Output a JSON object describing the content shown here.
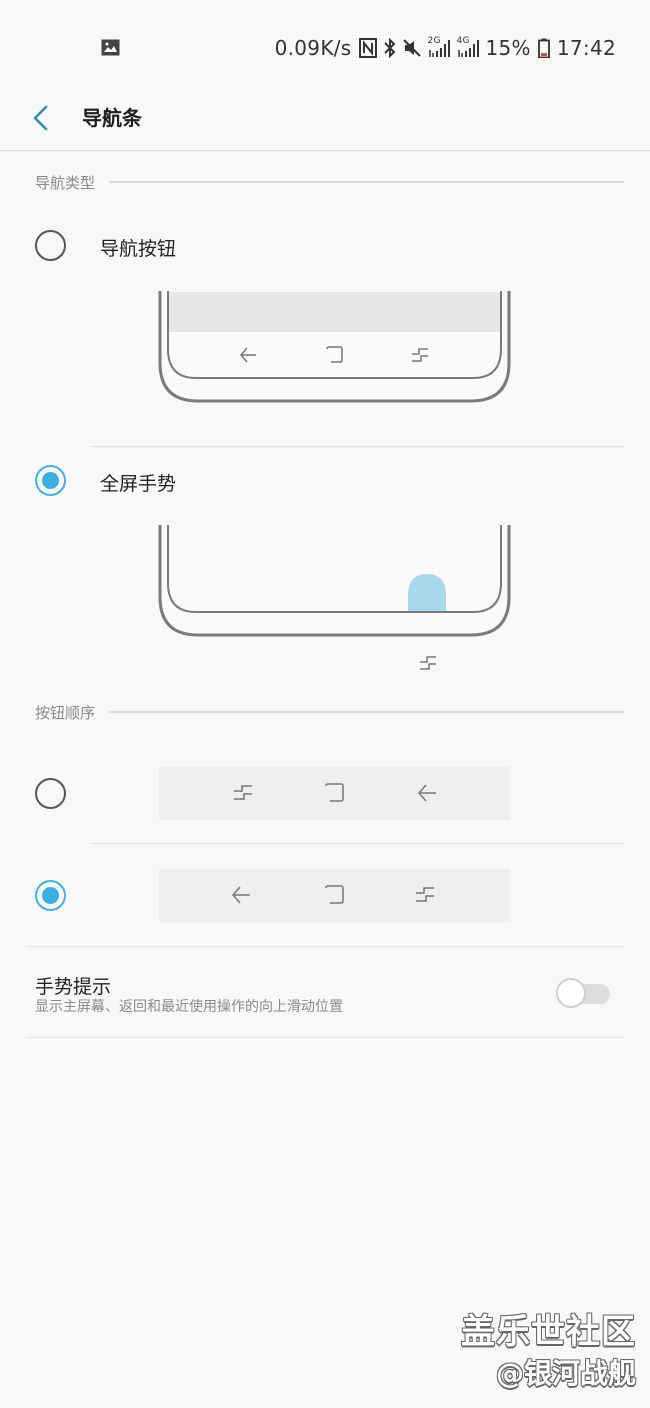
{
  "status_bar": {
    "speed": "0.09K/s",
    "battery_pct": "15%",
    "time": "17:42",
    "signal1_tag": "2G",
    "signal2_tag": "4G",
    "icons": [
      "image-icon",
      "nfc-icon",
      "bluetooth-icon",
      "mute-icon",
      "signal-icon",
      "battery-icon"
    ]
  },
  "header": {
    "title": "导航条"
  },
  "nav_type": {
    "section_title": "导航类型",
    "options": [
      {
        "label": "导航按钮",
        "checked": false
      },
      {
        "label": "全屏手势",
        "checked": true
      }
    ]
  },
  "button_order": {
    "section_title": "按钮顺序",
    "options": [
      {
        "keys": [
          "recents-icon",
          "home-icon",
          "back-icon"
        ],
        "checked": false
      },
      {
        "keys": [
          "back-icon",
          "home-icon",
          "recents-icon"
        ],
        "checked": true
      }
    ]
  },
  "gesture_hint": {
    "title": "手势提示",
    "description": "显示主屏幕、返回和最近使用操作的向上滑动位置",
    "enabled": false
  },
  "watermark": {
    "line1": "盖乐世社区",
    "line2": "@银河战舰"
  },
  "colors": {
    "accent": "#3aaee0",
    "gesture_handle": "#a8d8ec",
    "background": "#f8f8f8"
  }
}
